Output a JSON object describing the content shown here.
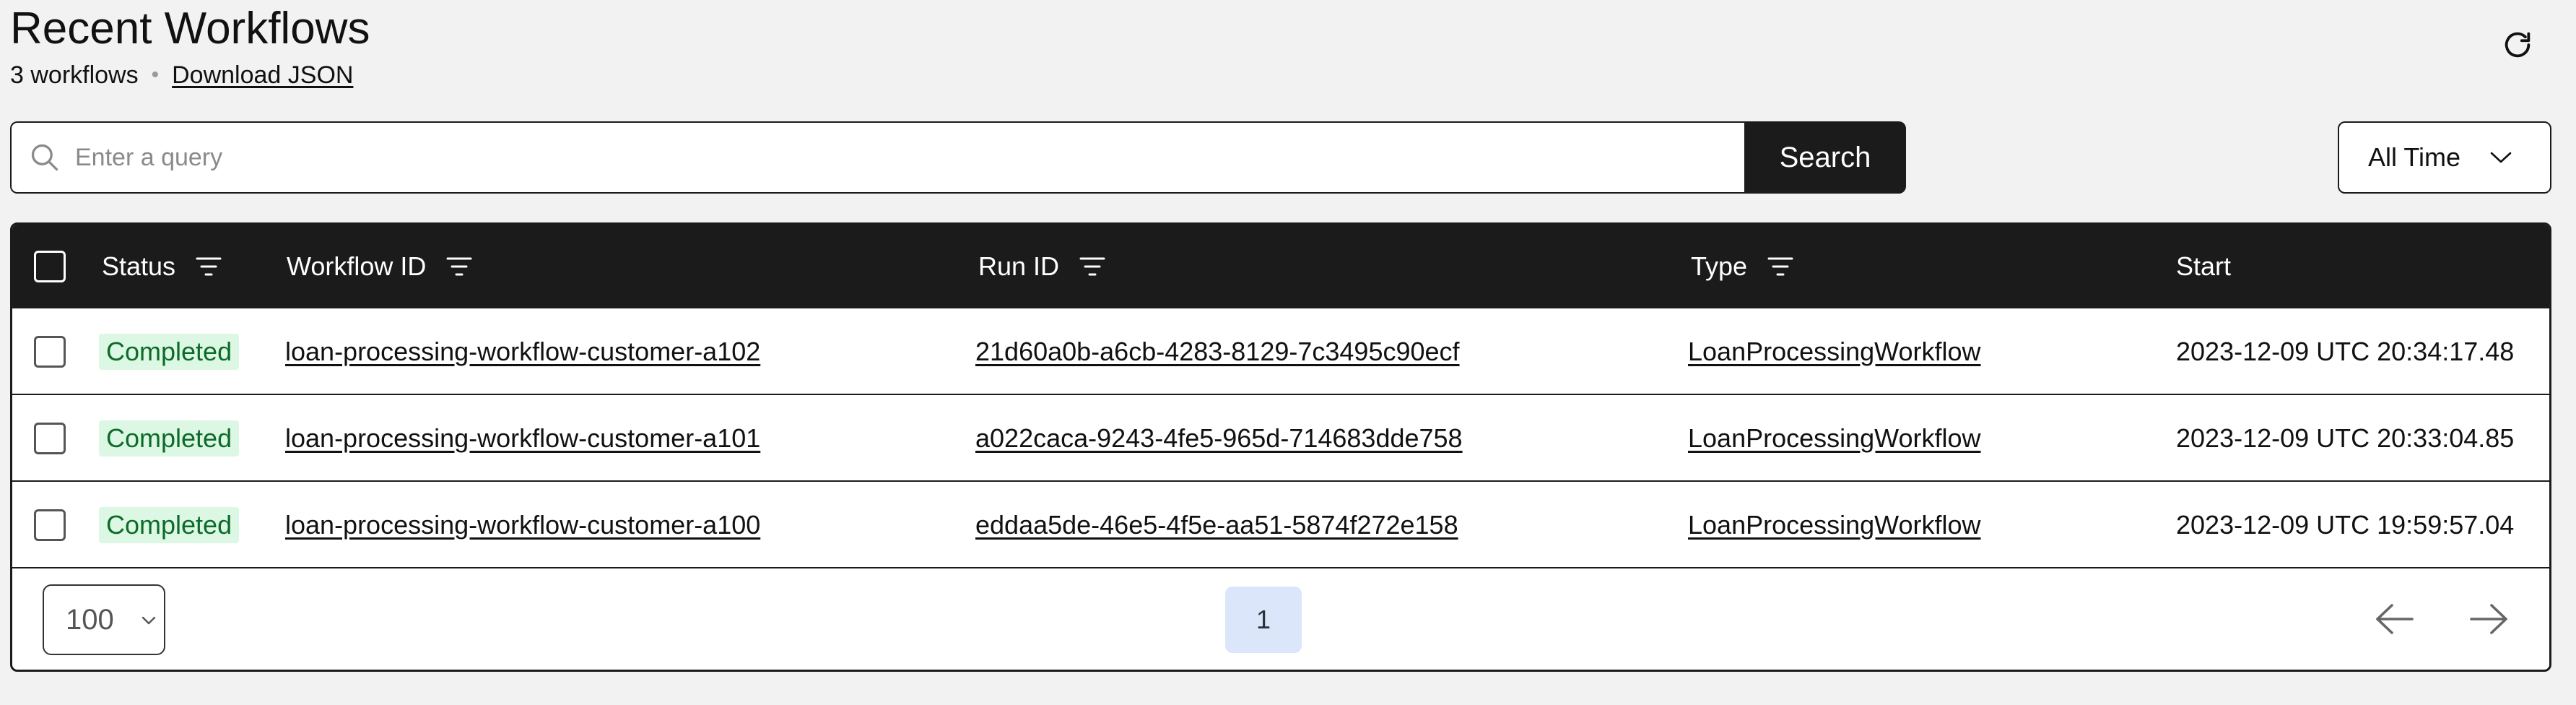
{
  "header": {
    "title": "Recent Workflows",
    "count_text": "3 workflows",
    "separator": "•",
    "download_label": "Download JSON"
  },
  "search": {
    "placeholder": "Enter a query",
    "value": "",
    "button_label": "Search"
  },
  "time_filter": {
    "selected": "All Time"
  },
  "table": {
    "columns": [
      "Status",
      "Workflow ID",
      "Run ID",
      "Type",
      "Start"
    ],
    "rows": [
      {
        "status": "Completed",
        "workflow_id": "loan-processing-workflow-customer-a102",
        "run_id": "21d60a0b-a6cb-4283-8129-7c3495c90ecf",
        "type": "LoanProcessingWorkflow",
        "start": "2023-12-09 UTC 20:34:17.48"
      },
      {
        "status": "Completed",
        "workflow_id": "loan-processing-workflow-customer-a101",
        "run_id": "a022caca-9243-4fe5-965d-714683dde758",
        "type": "LoanProcessingWorkflow",
        "start": "2023-12-09 UTC 20:33:04.85"
      },
      {
        "status": "Completed",
        "workflow_id": "loan-processing-workflow-customer-a100",
        "run_id": "eddaa5de-46e5-4f5e-aa51-5874f272e158",
        "type": "LoanProcessingWorkflow",
        "start": "2023-12-09 UTC 19:59:57.04"
      }
    ]
  },
  "pagination": {
    "page_size": "100",
    "current_page": "1"
  },
  "colors": {
    "header_bg": "#1b1b1b",
    "page_bg": "#f2f2f2",
    "badge_bg": "#dcf7e3",
    "badge_text": "#0d6b2a",
    "page_button_bg": "#dbe6fb"
  },
  "icons": {
    "refresh": "refresh-icon",
    "search": "search-icon",
    "chevron": "chevron-down-icon",
    "filter": "filter-icon",
    "prev": "arrow-left-icon",
    "next": "arrow-right-icon"
  }
}
